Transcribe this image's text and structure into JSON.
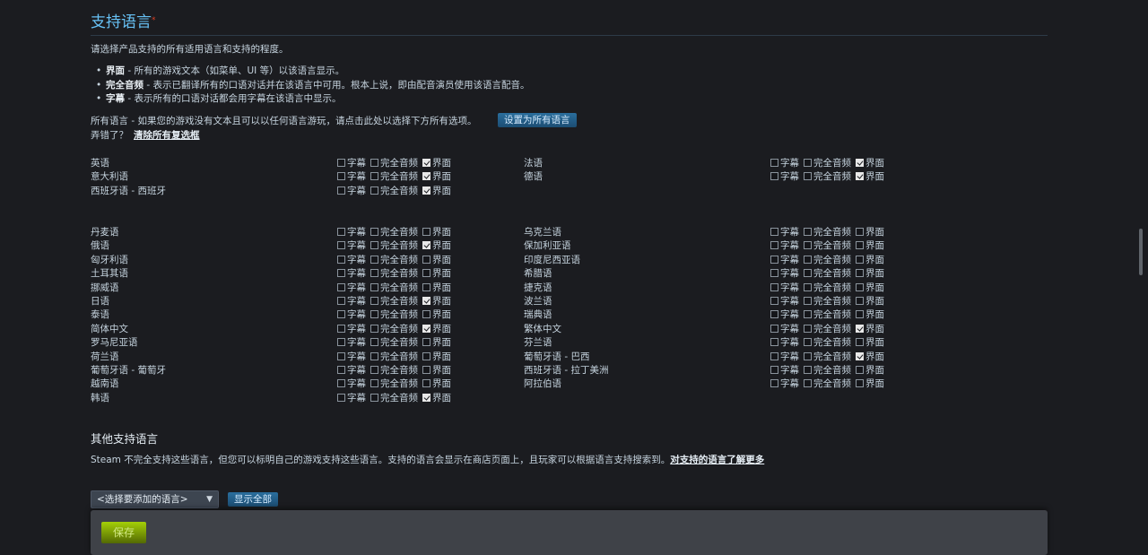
{
  "section": {
    "title": "支持语言",
    "required_mark": "*",
    "intro": "请选择产品支持的所有适用语言和支持的程度。",
    "bullets": [
      {
        "term": "界面",
        "text": " - 所有的游戏文本（如菜单、UI 等）以该语言显示。"
      },
      {
        "term": "完全音频",
        "text": " - 表示已翻译所有的口语对话并在该语言中可用。根本上说，即由配音演员使用该语言配音。"
      },
      {
        "term": "字幕",
        "text": " - 表示所有的口语对话都会用字幕在该语言中显示。"
      }
    ],
    "all_languages_text": "所有语言 - 如果您的游戏没有文本且可以以任何语言游玩，请点击此处以选择下方所有选项。",
    "set_all_button": "设置为所有语言",
    "wrong_text": "弄错了？",
    "clear_all_link": "清除所有复选框"
  },
  "option_labels": {
    "subtitles": "字幕",
    "full_audio": "完全音频",
    "interface": "界面"
  },
  "languages_group1": {
    "left": [
      {
        "name": "英语",
        "subtitles": false,
        "full_audio": false,
        "interface": true
      },
      {
        "name": "意大利语",
        "subtitles": false,
        "full_audio": false,
        "interface": true
      },
      {
        "name": "西班牙语 - 西班牙",
        "subtitles": false,
        "full_audio": false,
        "interface": true
      }
    ],
    "right": [
      {
        "name": "法语",
        "subtitles": false,
        "full_audio": false,
        "interface": true
      },
      {
        "name": "德语",
        "subtitles": false,
        "full_audio": false,
        "interface": true
      }
    ]
  },
  "languages_group2": {
    "left": [
      {
        "name": "丹麦语",
        "subtitles": false,
        "full_audio": false,
        "interface": false
      },
      {
        "name": "俄语",
        "subtitles": false,
        "full_audio": false,
        "interface": true
      },
      {
        "name": "匈牙利语",
        "subtitles": false,
        "full_audio": false,
        "interface": false
      },
      {
        "name": "土耳其语",
        "subtitles": false,
        "full_audio": false,
        "interface": false
      },
      {
        "name": "挪威语",
        "subtitles": false,
        "full_audio": false,
        "interface": false
      },
      {
        "name": "日语",
        "subtitles": false,
        "full_audio": false,
        "interface": true
      },
      {
        "name": "泰语",
        "subtitles": false,
        "full_audio": false,
        "interface": false
      },
      {
        "name": "简体中文",
        "subtitles": false,
        "full_audio": false,
        "interface": true
      },
      {
        "name": "罗马尼亚语",
        "subtitles": false,
        "full_audio": false,
        "interface": false
      },
      {
        "name": "荷兰语",
        "subtitles": false,
        "full_audio": false,
        "interface": false
      },
      {
        "name": "葡萄牙语 - 葡萄牙",
        "subtitles": false,
        "full_audio": false,
        "interface": false
      },
      {
        "name": "越南语",
        "subtitles": false,
        "full_audio": false,
        "interface": false
      },
      {
        "name": "韩语",
        "subtitles": false,
        "full_audio": false,
        "interface": true
      }
    ],
    "right": [
      {
        "name": "乌克兰语",
        "subtitles": false,
        "full_audio": false,
        "interface": false
      },
      {
        "name": "保加利亚语",
        "subtitles": false,
        "full_audio": false,
        "interface": false
      },
      {
        "name": "印度尼西亚语",
        "subtitles": false,
        "full_audio": false,
        "interface": false
      },
      {
        "name": "希腊语",
        "subtitles": false,
        "full_audio": false,
        "interface": false
      },
      {
        "name": "捷克语",
        "subtitles": false,
        "full_audio": false,
        "interface": false
      },
      {
        "name": "波兰语",
        "subtitles": false,
        "full_audio": false,
        "interface": false
      },
      {
        "name": "瑞典语",
        "subtitles": false,
        "full_audio": false,
        "interface": false
      },
      {
        "name": "繁体中文",
        "subtitles": false,
        "full_audio": false,
        "interface": true
      },
      {
        "name": "芬兰语",
        "subtitles": false,
        "full_audio": false,
        "interface": false
      },
      {
        "name": "葡萄牙语 - 巴西",
        "subtitles": false,
        "full_audio": false,
        "interface": true
      },
      {
        "name": "西班牙语 - 拉丁美洲",
        "subtitles": false,
        "full_audio": false,
        "interface": false
      },
      {
        "name": "阿拉伯语",
        "subtitles": false,
        "full_audio": false,
        "interface": false
      }
    ]
  },
  "other": {
    "title": "其他支持语言",
    "description": "Steam 不完全支持这些语言，但您可以标明自己的游戏支持这些语言。支持的语言会显示在商店页面上，且玩家可以根据语言支持搜索到。",
    "learn_more_link": "对支持的语言了解更多",
    "select_placeholder": "<选择要添加的语言>",
    "show_all_button": "显示全部"
  },
  "save_button": "保存"
}
